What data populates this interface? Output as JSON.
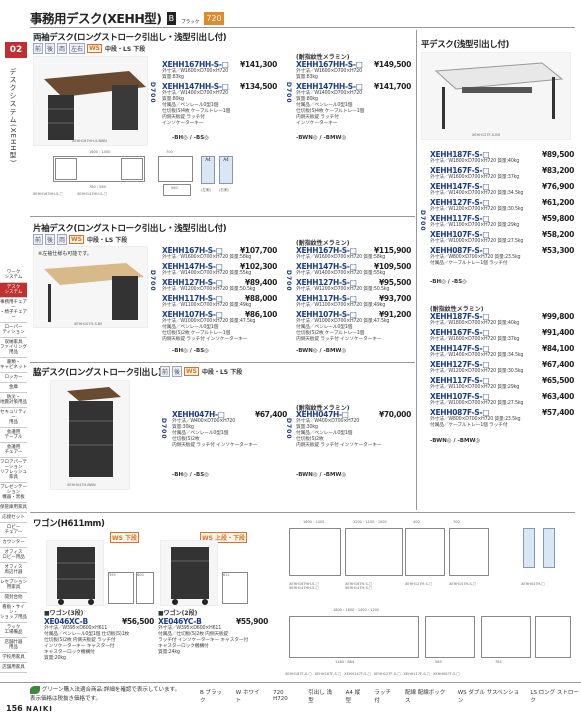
{
  "header": {
    "title": "事務用デスク(XEHH型)",
    "badge_b": "B",
    "badge_b2": "ブラック",
    "badge_720": "720"
  },
  "side": {
    "page_tab": "02",
    "section": "デスクシステム(XEHH型)",
    "items": [
      "ワーク\nシステム",
      "デスク\nシステム",
      "事務用チェアー\n・椅子チェアー",
      "ローパー\nティション",
      "収納家具\nファイリング用品",
      "書類・\nキャビネット",
      "ロッカー",
      "金庫",
      "防災・\n地震対策用品",
      "セキュリティー\n用品",
      "会議用\nテーブル",
      "会議用\nチェアー",
      "フロアパーテーション\nリフレッシュ家具",
      "プレゼンテーション\n機器・黒板",
      "保管庫用家具",
      "応接セット",
      "ロビー\nチェアー",
      "カウンター",
      "オフィス\nロビー用品",
      "オフィス\n周辺什器",
      "レセプション\n用家具",
      "開封台他",
      "看板・サイン・\nショップ用品",
      "ラック\n工場備品",
      "店舗什器\n用品",
      "学校用家具",
      "店舗用家具"
    ]
  },
  "s1": {
    "title": "両袖デスク(ロングストローク引出し・浅型引出し付)",
    "tags": [
      "前",
      "後",
      "両",
      "左右"
    ],
    "ws": "WS",
    "tags2": "中段・LS 下段",
    "img_cap": "XEHH167HH-S-BWN",
    "vdim": "D700",
    "std": [
      {
        "model": "XEHH167HH-S-□",
        "price": "¥141,300",
        "spec": "外寸法／W1600×D700×H720\n質量:83kg"
      },
      {
        "model": "XEHH147HH-S-□",
        "price": "¥134,500",
        "spec": "外寸法／W1400×D700×H720\n質量:80kg\n付属品／ペンレール0型1個\n仕切板(S)4枚 ケーブルトレー1個\n内側天板錠 ラッチ付\nインソケーターキー"
      }
    ],
    "std_colors": "-BH◎ / -BS◎",
    "embo_head": "(耐指紋性メラミン)",
    "emb": [
      {
        "model": "XEHH167HH-S-□",
        "price": "¥149,500",
        "spec": "外寸法／W1600×D700×H720\n質量:83kg"
      },
      {
        "model": "XEHH147HH-S-□",
        "price": "¥141,700",
        "spec": "外寸法／W1400×D700×H720\n質量:80kg\n付属品／ペンレール0型1個\n仕切板(S)4枚 ケーブルトレー1個\n内側天板錠 ラッチ付\nインソケーターキー"
      }
    ],
    "emb_colors": "-BWN◎ / -BMW◎",
    "dims": [
      "1600・1400",
      "700",
      "780・589",
      "100",
      "580",
      "A4",
      "A4"
    ],
    "draw_caps": [
      "XEHH167HH-S-□",
      "XEHH147HH-S-□",
      "(左側)",
      "(右側)"
    ]
  },
  "s2": {
    "title": "平デスク(浅型引出し付)",
    "img_cap": "XEHH127F-S-BH",
    "vdim": "D700",
    "std": [
      {
        "model": "XEHH187F-S-□",
        "price": "¥89,500",
        "spec": "外寸法／W1800×D700×H720 質量:40kg"
      },
      {
        "model": "XEHH167F-S-□",
        "price": "¥83,200",
        "spec": "外寸法／W1600×D700×H720 質量:37kg"
      },
      {
        "model": "XEHH147F-S-□",
        "price": "¥76,900",
        "spec": "外寸法／W1400×D700×H720 質量:34.5kg"
      },
      {
        "model": "XEHH127F-S-□",
        "price": "¥61,200",
        "spec": "外寸法／W1200×D700×H720 質量:30.5kg"
      },
      {
        "model": "XEHH117F-S-□",
        "price": "¥59,800",
        "spec": "外寸法／W1100×D700×H720 質量:29kg"
      },
      {
        "model": "XEHH107F-S-□",
        "price": "¥58,200",
        "spec": "外寸法／W1000×D700×H720 質量:27.5kg"
      },
      {
        "model": "XEHH087F-S-□",
        "price": "¥53,300",
        "spec": "外寸法／W800×D700×H720 質量:23.5kg\n付属品／ケーブルトレー1個 ラッチ付"
      }
    ],
    "std_colors": "-BH◎ / -BS◎",
    "embo_head": "(耐指紋性メラミン)",
    "emb": [
      {
        "model": "XEHH187F-S-□",
        "price": "¥99,800",
        "spec": "外寸法／W1800×D700×H720 質量:40kg"
      },
      {
        "model": "XEHH167F-S-□",
        "price": "¥91,400",
        "spec": "外寸法／W1600×D700×H720 質量:37kg"
      },
      {
        "model": "XEHH147F-S-□",
        "price": "¥84,100",
        "spec": "外寸法／W1400×D700×H720 質量:34.5kg"
      },
      {
        "model": "XEHH127F-S-□",
        "price": "¥67,400",
        "spec": "外寸法／W1200×D700×H720 質量:30.5kg"
      },
      {
        "model": "XEHH117F-S-□",
        "price": "¥65,500",
        "spec": "外寸法／W1100×D700×H720 質量:29kg"
      },
      {
        "model": "XEHH107F-S-□",
        "price": "¥63,400",
        "spec": "外寸法／W1000×D700×H720 質量:27.5kg"
      },
      {
        "model": "XEHH087F-S-□",
        "price": "¥57,400",
        "spec": "外寸法／W800×D700×H720 質量:23.5kg\n付属品／ケーブルトレー1個 ラッチ付"
      }
    ],
    "emb_colors": "-BWN◎ / -BMW◎"
  },
  "s3": {
    "title": "片袖デスク(ロングストローク引出し・浅型引出し付)",
    "ws": "WS",
    "tags2": "中段・LS 下段",
    "img_note": "※左袖仕様も可能です。",
    "img_cap": "XEHH107H-S-BS",
    "vdim": "D700",
    "std": [
      {
        "model": "XEHH167H-S-□",
        "price": "¥107,700",
        "spec": "外寸法／W1600×D700×H720 質量:58kg"
      },
      {
        "model": "XEHH147H-S-□",
        "price": "¥102,300",
        "spec": "外寸法／W1400×D700×H720 質量:55kg"
      },
      {
        "model": "XEHH127H-S-□",
        "price": "¥89,400",
        "spec": "外寸法／W1200×D700×H720 質量:50.5kg"
      },
      {
        "model": "XEHH117H-S-□",
        "price": "¥88,000",
        "spec": "外寸法／W1100×D700×H720 質量:49kg"
      },
      {
        "model": "XEHH107H-S-□",
        "price": "¥86,100",
        "spec": "外寸法／W1000×D700×H720 質量:47.5kg\n付属品／ペンレール0型1個\n仕切板(S)2枚 ケーブルトレー1個\n内側天板錠 ラッチ付 インソケーターキー"
      }
    ],
    "std_colors": "-BH◎ / -BS◎",
    "embo_head": "(耐指紋性メラミン)",
    "emb": [
      {
        "model": "XEHH167H-S-□",
        "price": "¥115,900",
        "spec": "外寸法／W1600×D700×H720 質量:58kg"
      },
      {
        "model": "XEHH147H-S-□",
        "price": "¥109,500",
        "spec": "外寸法／W1400×D700×H720 質量:55kg"
      },
      {
        "model": "XEHH127H-S-□",
        "price": "¥95,500",
        "spec": "外寸法／W1200×D700×H720 質量:50.5kg"
      },
      {
        "model": "XEHH117H-S-□",
        "price": "¥93,700",
        "spec": "外寸法／W1100×D700×H720 質量:49kg"
      },
      {
        "model": "XEHH107H-S-□",
        "price": "¥91,200",
        "spec": "外寸法／W1000×D700×H720 質量:47.5kg\n付属品／ペンレール0型1個\n仕切板(S)2枚 ケーブルトレー1個\n内側天板錠 ラッチ付 インソケーターキー"
      }
    ],
    "emb_colors": "-BWN◎ / -BMW◎"
  },
  "s4": {
    "title": "脇デスク(ロングストローク引出し)",
    "ws": "WS",
    "tags2": "中段・LS 下段",
    "img_cap": "XEHH047H-BWN",
    "vdim": "D700",
    "std": [
      {
        "model": "XEHH047H-□",
        "price": "¥67,400",
        "spec": "外寸法／W400×D700×H720\n質量:30kg\n付属品／ペンレール0型1個\n仕切板(S)2枚\n内側天板錠 ラッチ付 インソケーターキー"
      }
    ],
    "std_colors": "-BH◎ / -BS◎",
    "embo_head": "(耐指紋性メラミン)",
    "emb": [
      {
        "model": "XEHH047H-□",
        "price": "¥70,000",
        "spec": "外寸法／W400×D700×H720\n質量:30kg\n付属品／ペンレール0型1個\n仕切板(S)2枚\n内側天板錠 ラッチ付 インソケーターキー"
      }
    ],
    "emb_colors": "-BWN◎ / -BMW◎"
  },
  "s5": {
    "title": "ワゴン(H611mm)",
    "tag_a": "WS 下段",
    "tag_b": "WS 上段・下段",
    "a": {
      "head": "■ワゴン(3段)",
      "model": "XE046XC-B",
      "price": "¥56,500",
      "spec": "外寸法／W395×D600×H611\n付属品／ペンレール0型1個 仕切板(S)1枚\n仕切板(S)2枚 内側天板錠 ラッチ付\nインソケーターキー キャスター付\nキャスターロック機構付\n質量:20kg"
    },
    "b": {
      "head": "■ワゴン(2段)",
      "model": "XE046YC-B",
      "price": "¥55,900",
      "spec": "外寸法／W395×D600×H611\n付属品／仕切板(S)2枚 内側天板錠\nラッチ付 インソケーターキー キャスター付\nキャスターロック機構付\n質量:24kg"
    },
    "dims": [
      "395",
      "600",
      "611"
    ]
  },
  "plans": {
    "caps": [
      "XEHH167HH-S-□\nXEHH147HH-S-□",
      "XEHH167H-S-□\nXEHH147H-S-□",
      "XEHH127H-S-□",
      "XEHH107H-S-□",
      "XEHH047H-□",
      "XEHH187F-S-□",
      "XEHH167F-S-□",
      "XEHH147F-S-□",
      "XEHH127F-S-□",
      "XEHH117F-S-□",
      "XEHH087F-S-□"
    ],
    "dims": [
      "1600・1400",
      "1200・1100・1000",
      "400",
      "700",
      "1800・1600・1400・1200",
      "1184・884",
      "589",
      "784"
    ]
  },
  "footer": {
    "note": "グリーン購入法適合商品:詳細を確認で表示しています。",
    "note2": "表示価格は税抜き価格です。",
    "page": "156",
    "brand": "NAIKI",
    "legend": [
      "B ブラック",
      "W ホワイト",
      "720 H720",
      "引出し 浅型",
      "A4 縦型",
      "ラッチ付",
      "配線 配線ボックス",
      "WS ダブル サスペンション",
      "LS ロング ストローク"
    ]
  }
}
